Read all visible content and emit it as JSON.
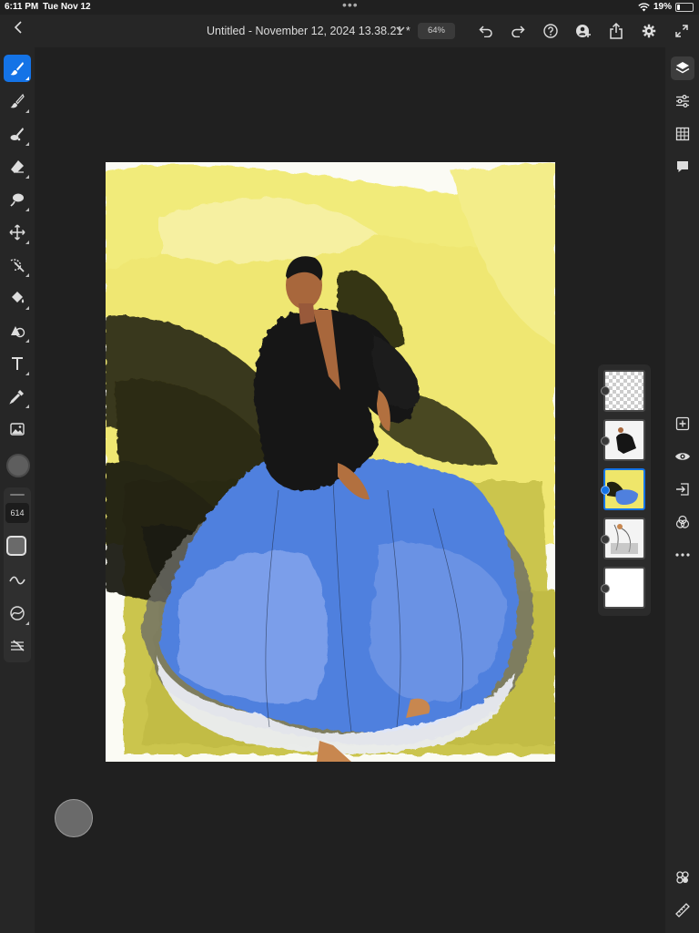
{
  "status_bar": {
    "time": "6:11 PM",
    "date": "Tue Nov 12",
    "battery_percent": "19%",
    "battery_level": 0.19,
    "icons": [
      "multitask-dots-icon",
      "wifi-icon",
      "battery-icon"
    ]
  },
  "header": {
    "document_title": "Untitled - November 12, 2024 13.38.21 *",
    "zoom": "64%",
    "actions": [
      "undo-icon",
      "redo-icon",
      "help-icon",
      "invite-icon",
      "share-icon",
      "settings-icon",
      "fullscreen-icon"
    ]
  },
  "left_toolbar": {
    "tools": [
      "paint-brush",
      "pixel-brush",
      "smudge",
      "eraser",
      "lasso-selection",
      "move-transform",
      "quick-selection",
      "fill",
      "shape",
      "type",
      "eyedropper",
      "place-image"
    ],
    "active_tool": "paint-brush",
    "brush_size": "614",
    "current_color": "#5e5e5e"
  },
  "right_toolbar": {
    "tools": [
      "layers",
      "adjustments",
      "grid",
      "comments",
      "add-layer",
      "visibility",
      "import",
      "blend-modes",
      "more",
      "assets",
      "ruler"
    ],
    "active": "layers"
  },
  "layers_panel": {
    "layers": [
      {
        "name": "transparent layer",
        "selected": false
      },
      {
        "name": "jacket figure",
        "selected": false
      },
      {
        "name": "color paint",
        "selected": true
      },
      {
        "name": "sketch reference",
        "selected": false
      },
      {
        "name": "white background",
        "selected": false
      }
    ]
  },
  "colors": {
    "accent": "#1473e6",
    "background": "#202020",
    "panel": "#262626",
    "canvas_yellow": "#f1e96c",
    "canvas_olive": "#c9c24a",
    "dress_blue": "#4f7fdc",
    "jacket_black": "#141414"
  }
}
